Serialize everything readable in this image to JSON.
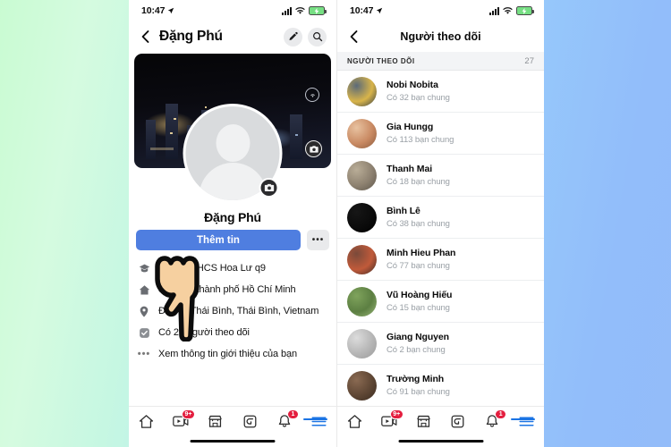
{
  "background": {
    "from": "#c9fbd2",
    "to": "#93bcf9"
  },
  "status_bar": {
    "time": "10:47",
    "location_icon": "location-arrow-icon",
    "signal_icon": "cellular-signal-icon",
    "wifi_icon": "wifi-icon",
    "battery_icon": "battery-charging-icon"
  },
  "left_phone": {
    "header": {
      "back_icon": "back-chevron-icon",
      "title": "Đặng Phú",
      "edit_icon": "pencil-icon",
      "search_icon": "search-icon"
    },
    "profile": {
      "name": "Đặng Phú",
      "cover_camera_icon": "camera-icon",
      "avatar_camera_icon": "camera-icon",
      "avatar_icon": "default-avatar-icon",
      "primary_button": "Thêm tin",
      "more_button": "•••",
      "primary_color": "#4f7ee0",
      "details": [
        {
          "icon": "graduation-cap-icon",
          "text": "Học tại THCS Hoa Lư q9"
        },
        {
          "icon": "home-icon",
          "text": "Sống tại thành phố Hồ Chí Minh"
        },
        {
          "icon": "location-pin-icon",
          "text": "Đến từ Thái Bình, Thái Bình, Vietnam"
        },
        {
          "icon": "check-badge-icon",
          "text": "Có 27 người theo dõi"
        },
        {
          "icon": "ellipsis-icon",
          "text": "Xem thông tin giới thiệu của bạn"
        }
      ]
    }
  },
  "right_phone": {
    "header": {
      "back_icon": "back-chevron-icon",
      "title": "Người theo dõi"
    },
    "list": {
      "section_label": "NGƯỜI THEO DÕI",
      "count": "27",
      "followers": [
        {
          "name": "Nobi Nobita",
          "mutual": "Có 32 bạn chung",
          "avatar_colors": [
            "#5b6a78",
            "#d8b44a",
            "#2f3a46"
          ]
        },
        {
          "name": "Gia Hungg",
          "mutual": "Có 113 bạn chung",
          "avatar_colors": [
            "#e8c2a0",
            "#c98a63",
            "#8a5a3c"
          ]
        },
        {
          "name": "Thanh Mai",
          "mutual": "Có 18 bạn chung",
          "avatar_colors": [
            "#b9ad97",
            "#8d8170",
            "#5d564b"
          ]
        },
        {
          "name": "Bình Lê",
          "mutual": "Có 38 bạn chung",
          "avatar_colors": [
            "#161616",
            "#0b0b0b",
            "#000000"
          ]
        },
        {
          "name": "Minh Hieu Phan",
          "mutual": "Có 77 bạn chung",
          "avatar_colors": [
            "#7a4a3a",
            "#c05a3a",
            "#3a2a24"
          ]
        },
        {
          "name": "Vũ Hoàng Hiếu",
          "mutual": "Có 15 bạn chung",
          "avatar_colors": [
            "#7fa35c",
            "#5c7f42",
            "#9ab77a"
          ]
        },
        {
          "name": "Giang Nguyen",
          "mutual": "Có 2 bạn chung",
          "avatar_colors": [
            "#dcdcdc",
            "#b6b6b6",
            "#9a9a9a"
          ]
        },
        {
          "name": "Trường Minh",
          "mutual": "Có 91 bạn chung",
          "avatar_colors": [
            "#8a6a52",
            "#5e4634",
            "#3a2b20"
          ]
        }
      ]
    }
  },
  "tabbar": {
    "items": [
      {
        "icon": "home-icon",
        "badge": ""
      },
      {
        "icon": "video-icon",
        "badge": "9+"
      },
      {
        "icon": "marketplace-icon",
        "badge": ""
      },
      {
        "icon": "groups-icon",
        "badge": ""
      },
      {
        "icon": "bell-icon",
        "badge": "1"
      },
      {
        "icon": "hamburger-menu-icon",
        "badge": ""
      }
    ],
    "badge_color": "#e41e3f",
    "active_color": "#1b74e4"
  },
  "pointer": {
    "icon": "pointing-hand-cursor"
  }
}
